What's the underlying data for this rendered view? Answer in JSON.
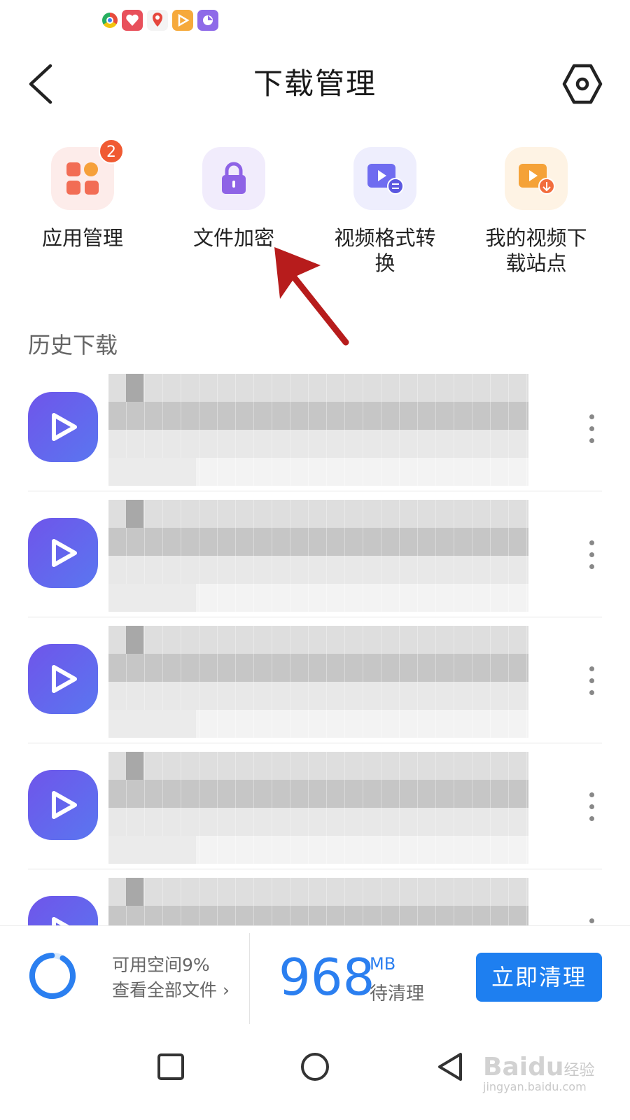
{
  "status_bar": {
    "icons": [
      "chrome-icon",
      "health-app-icon",
      "map-pin-app-icon",
      "video-player-app-icon",
      "camera-app-icon"
    ]
  },
  "header": {
    "title": "下载管理",
    "back_icon": "chevron-left-icon",
    "settings_icon": "hex-settings-icon"
  },
  "tools": [
    {
      "label": "应用管理",
      "icon": "apps-grid-icon",
      "badge": "2",
      "color": "#f26d55",
      "bg": "#fdecea"
    },
    {
      "label": "文件加密",
      "icon": "lock-icon",
      "badge": null,
      "color": "#8e63e6",
      "bg": "#f1ecfc"
    },
    {
      "label": "视频格式转换",
      "icon": "video-convert-icon",
      "badge": null,
      "color": "#6f6cf0",
      "bg": "#eeeefd"
    },
    {
      "label": "我的视频下载站点",
      "icon": "video-download-icon",
      "badge": null,
      "color": "#f5a238",
      "bg": "#fef3e4"
    }
  ],
  "history": {
    "title": "历史下载",
    "items": [
      {
        "icon": "video-play-icon"
      },
      {
        "icon": "video-play-icon"
      },
      {
        "icon": "video-play-icon"
      },
      {
        "icon": "video-play-icon"
      },
      {
        "icon": "video-play-icon"
      }
    ]
  },
  "storage": {
    "available": "可用空间9%",
    "view_all": "查看全部文件",
    "clean_size": "968",
    "unit": "MB",
    "pending": "待清理",
    "clean_button": "立即清理",
    "accent": "#1e7ff0"
  },
  "nav": {
    "icons": [
      "recent-apps-icon",
      "home-icon",
      "back-triangle-icon"
    ]
  },
  "watermark": {
    "brand": "Baidu",
    "cn": "经验",
    "url": "jingyan.baidu.com"
  }
}
